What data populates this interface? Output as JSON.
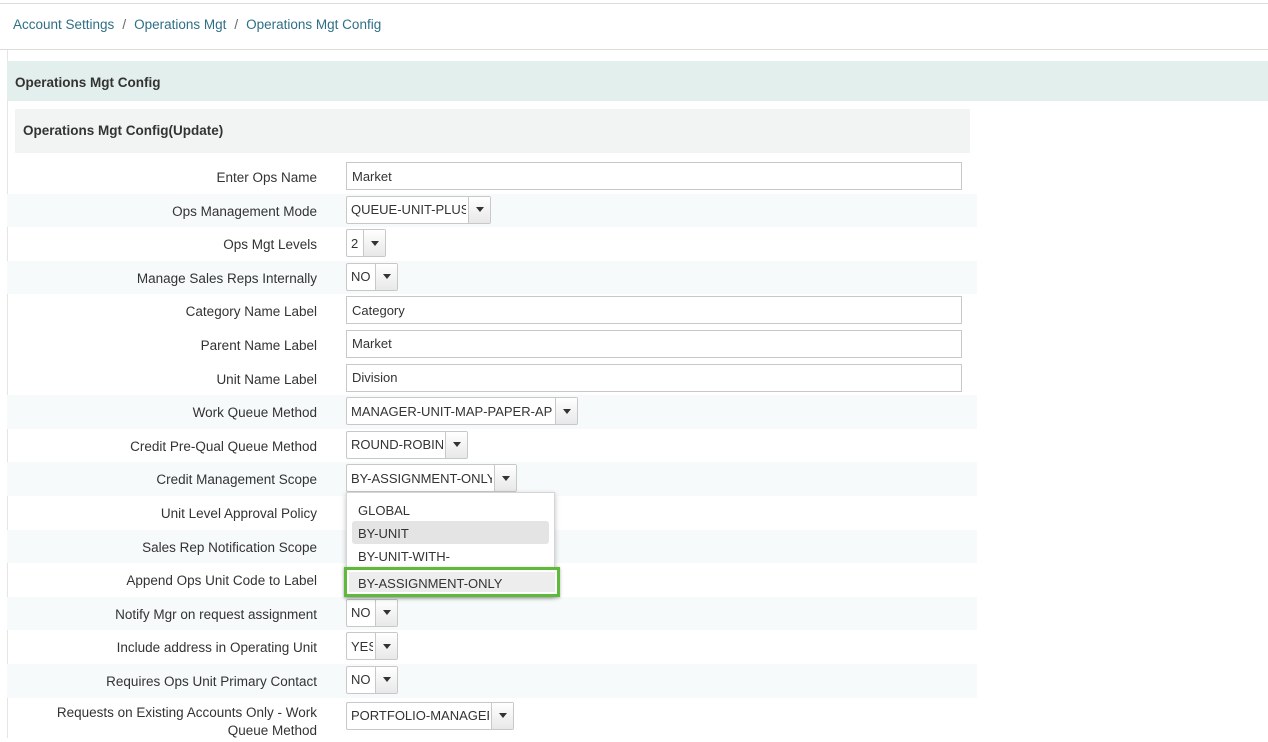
{
  "breadcrumb": [
    "Account Settings",
    "Operations Mgt",
    "Operations Mgt Config"
  ],
  "panel_title": "Operations Mgt Config",
  "form_title": "Operations Mgt Config(Update)",
  "fields": [
    {
      "label": "Enter Ops Name",
      "type": "text",
      "value": "Market"
    },
    {
      "label": "Ops Management Mode",
      "type": "select",
      "value": "QUEUE-UNIT-PLUS"
    },
    {
      "label": "Ops Mgt Levels",
      "type": "select",
      "value": "2"
    },
    {
      "label": "Manage Sales Reps Internally",
      "type": "select",
      "value": "NO"
    },
    {
      "label": "Category Name Label",
      "type": "text",
      "value": "Category"
    },
    {
      "label": "Parent Name Label",
      "type": "text",
      "value": "Market"
    },
    {
      "label": "Unit Name Label",
      "type": "text",
      "value": "Division"
    },
    {
      "label": "Work Queue Method",
      "type": "select",
      "value": "MANAGER-UNIT-MAP-PAPER-APP"
    },
    {
      "label": "Credit Pre-Qual Queue Method",
      "type": "select",
      "value": "ROUND-ROBIN"
    },
    {
      "label": "Credit Management Scope",
      "type": "select",
      "value": "BY-ASSIGNMENT-ONLY"
    },
    {
      "label": "Unit Level Approval Policy",
      "type": "hidden",
      "value": ""
    },
    {
      "label": "Sales Rep Notification Scope",
      "type": "hidden",
      "value": ""
    },
    {
      "label": "Append Ops Unit Code to Label",
      "type": "hidden",
      "value": ""
    },
    {
      "label": "Notify Mgr on request assignment",
      "type": "select",
      "value": "NO"
    },
    {
      "label": "Include address in Operating Unit",
      "type": "select",
      "value": "YES"
    },
    {
      "label": "Requires Ops Unit Primary Contact",
      "type": "select",
      "value": "NO"
    },
    {
      "label": "Requests on Existing Accounts Only - Work Queue Method",
      "type": "select",
      "value": "PORTFOLIO-MANAGER"
    }
  ],
  "dropdown": {
    "options": [
      "GLOBAL",
      "BY-UNIT",
      "BY-UNIT-WITH-REASSIGNMENT",
      "BY-ASSIGNMENT-ONLY"
    ],
    "hovered": "BY-UNIT",
    "selected": "BY-ASSIGNMENT-ONLY",
    "highlight_color": "#5fba3b"
  },
  "colors": {
    "link": "#2f6f86",
    "panel_header_bg": "#e2efec",
    "row_stripe": "#f6fafb"
  }
}
